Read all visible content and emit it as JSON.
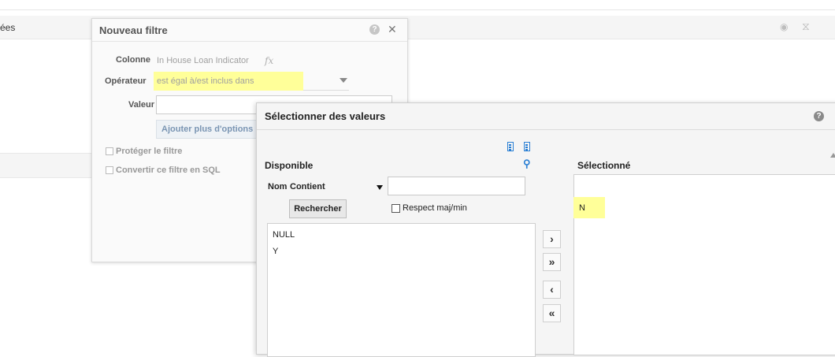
{
  "background": {
    "header_label": "ées",
    "icons": [
      "eye-icon",
      "filter-clear-icon"
    ]
  },
  "filter_dialog": {
    "title": "Nouveau filtre",
    "help_label": "?",
    "close_label": "✕",
    "column_label": "Colonne",
    "column_value": "In House Loan Indicator",
    "fx_label": "fx",
    "operator_label": "Opérateur",
    "operator_value": "est égal à/est inclus dans",
    "value_label": "Valeur",
    "value_input": "",
    "add_options_label": "Ajouter plus d'options",
    "protect_label": "Protéger le filtre",
    "convert_sql_label": "Convertir ce filtre en SQL"
  },
  "select_dialog": {
    "title": "Sélectionner des valeurs",
    "help_label": "?",
    "available_title": "Disponible",
    "name_label": "Nom",
    "match_select": "Contient",
    "search_value": "",
    "search_button": "Rechercher",
    "case_label": "Respect maj/min",
    "available_items": [
      "NULL",
      "Y"
    ],
    "move_buttons": {
      "move": "›",
      "move_all": "»",
      "remove": "‹",
      "remove_all": "«"
    },
    "selected_title": "Sélectionné",
    "selected_items": [
      "N"
    ],
    "highlight_color": "#ffff99",
    "accent_color": "#2a7fd4"
  }
}
